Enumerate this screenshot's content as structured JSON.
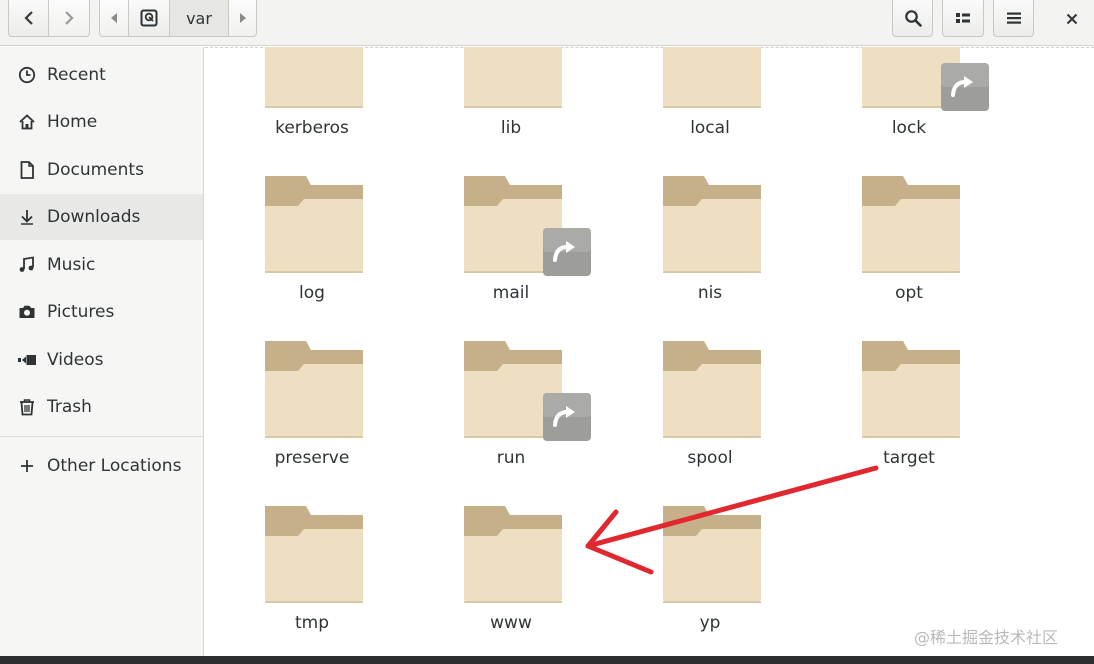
{
  "header": {
    "path": {
      "current": "var"
    }
  },
  "sidebar": {
    "items": [
      {
        "label": "Recent",
        "icon": "recent-icon"
      },
      {
        "label": "Home",
        "icon": "home-icon"
      },
      {
        "label": "Documents",
        "icon": "document-icon"
      },
      {
        "label": "Downloads",
        "icon": "download-icon",
        "selected": true
      },
      {
        "label": "Music",
        "icon": "music-icon"
      },
      {
        "label": "Pictures",
        "icon": "camera-icon"
      },
      {
        "label": "Videos",
        "icon": "video-icon"
      },
      {
        "label": "Trash",
        "icon": "trash-icon"
      }
    ],
    "other_locations": {
      "label": "Other Locations",
      "icon": "plus-icon"
    }
  },
  "folders": [
    {
      "name": "kerberos",
      "symlink": false
    },
    {
      "name": "lib",
      "symlink": false
    },
    {
      "name": "local",
      "symlink": false
    },
    {
      "name": "lock",
      "symlink": true
    },
    {
      "name": "log",
      "symlink": false
    },
    {
      "name": "mail",
      "symlink": true
    },
    {
      "name": "nis",
      "symlink": false
    },
    {
      "name": "opt",
      "symlink": false
    },
    {
      "name": "preserve",
      "symlink": false
    },
    {
      "name": "run",
      "symlink": true
    },
    {
      "name": "spool",
      "symlink": false
    },
    {
      "name": "target",
      "symlink": false
    },
    {
      "name": "tmp",
      "symlink": false
    },
    {
      "name": "www",
      "symlink": false
    },
    {
      "name": "yp",
      "symlink": false
    }
  ],
  "annotation": {
    "type": "red-arrow",
    "color": "#e0282e",
    "from_folder": "target",
    "to_folder": "www"
  },
  "watermark": "@稀土掘金技术社区",
  "colors": {
    "folder_back": "#c6b08a",
    "folder_front": "#efdfc2",
    "emblem": "#9d9d9a"
  }
}
